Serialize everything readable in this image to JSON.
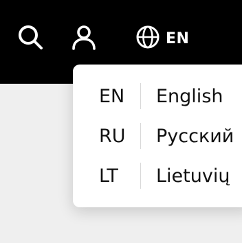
{
  "header": {
    "search_icon": "search-icon",
    "user_icon": "user-icon",
    "language": {
      "icon": "globe-icon",
      "current_code": "EN"
    }
  },
  "language_menu": {
    "options": [
      {
        "code": "EN",
        "name": "English"
      },
      {
        "code": "RU",
        "name": "Русский"
      },
      {
        "code": "LT",
        "name": "Lietuvių"
      }
    ]
  },
  "colors": {
    "header_bg": "#000000",
    "page_bg": "#efefef",
    "menu_bg": "#ffffff",
    "text": "#111111",
    "separator": "#d8d8d8"
  }
}
